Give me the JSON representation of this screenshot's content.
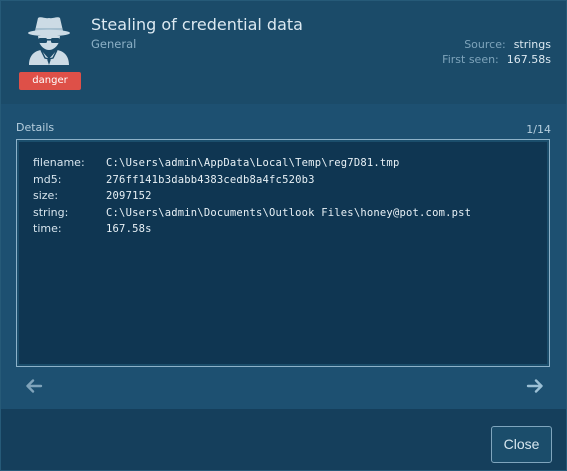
{
  "signature": {
    "title": "Stealing of credential data",
    "category": "General",
    "severity": "danger",
    "icon": "spy-icon",
    "severity_color": "#de5048"
  },
  "meta": {
    "source_label": "Source:",
    "source_value": "strings",
    "first_seen_label": "First seen:",
    "first_seen_value": "167.58s"
  },
  "details": {
    "label": "Details",
    "counter": "1/14",
    "rows": [
      {
        "key": "filename:",
        "value": "C:\\Users\\admin\\AppData\\Local\\Temp\\reg7D81.tmp"
      },
      {
        "key": "md5:",
        "value": "276ff141b3dabb4383cedb8a4fc520b3"
      },
      {
        "key": "size:",
        "value": "2097152"
      },
      {
        "key": "string:",
        "value": "C:\\Users\\admin\\Documents\\Outlook Files\\honey@pot.com.pst"
      },
      {
        "key": "time:",
        "value": "167.58s"
      }
    ]
  },
  "navigation": {
    "prev_icon": "arrow-left-icon",
    "next_icon": "arrow-right-icon"
  },
  "footer": {
    "close_label": "Close"
  }
}
